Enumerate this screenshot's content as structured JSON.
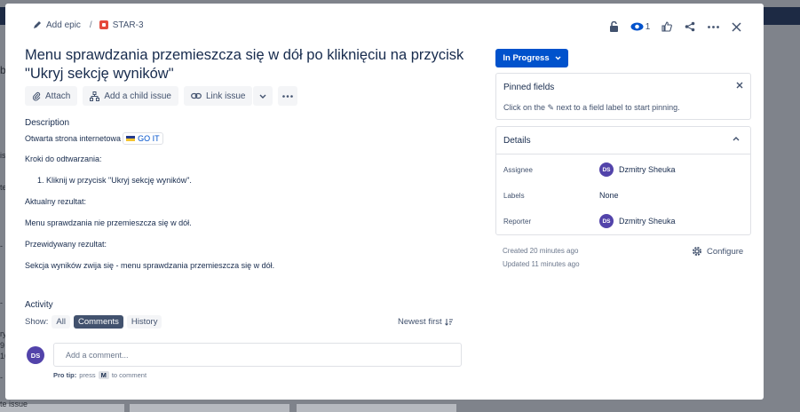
{
  "background": {
    "side_texts": [
      "b",
      "is",
      "te",
      "-",
      "-",
      "ry",
      "9",
      "16",
      "-",
      "te issue"
    ]
  },
  "header": {
    "add_epic": "Add epic",
    "separator": "/",
    "issue_key": "STAR-3",
    "watch_count": "1"
  },
  "issue": {
    "title": "Menu sprawdzania przemieszcza się w dół po kliknięciu na przycisk \"Ukryj sekcję wyników\""
  },
  "toolbar": {
    "attach": "Attach",
    "child_issue": "Add a child issue",
    "link_issue": "Link issue"
  },
  "description": {
    "label": "Description",
    "line1": "Otwarta strona internetowa",
    "link_text": "GO IT",
    "steps_label": "Kroki do odtwarzania:",
    "step1": "1. Kliknij w przycisk \"Ukryj sekcję wyników\".",
    "actual_label": "Aktualny rezultat:",
    "actual": "Menu sprawdzania nie przemieszcza się w dół.",
    "expected_label": "Przewidywany rezultat:",
    "expected": "Sekcja wyników zwija się - menu sprawdzania przemieszcza się w dół."
  },
  "activity": {
    "label": "Activity",
    "show": "Show:",
    "filters": [
      "All",
      "Comments",
      "History"
    ],
    "sort": "Newest first",
    "comment_placeholder": "Add a comment...",
    "user_initials": "DS",
    "protip_label": "Pro tip:",
    "protip_press": "press",
    "protip_key": "M",
    "protip_rest": "to comment"
  },
  "status": {
    "label": "In Progress"
  },
  "pinned": {
    "title": "Pinned fields",
    "text": "Click on the ✎ next to a field label to start pinning."
  },
  "details": {
    "title": "Details",
    "assignee_label": "Assignee",
    "assignee": "Dzmitry Sheuka",
    "labels_label": "Labels",
    "labels": "None",
    "reporter_label": "Reporter",
    "reporter": "Dzmitry Sheuka",
    "initials": "DS"
  },
  "meta": {
    "created": "Created 20 minutes ago",
    "updated": "Updated 11 minutes ago",
    "configure": "Configure"
  },
  "colors": {
    "accent": "#0052cc",
    "avatar": "#5243aa",
    "story": "#e5493a"
  }
}
